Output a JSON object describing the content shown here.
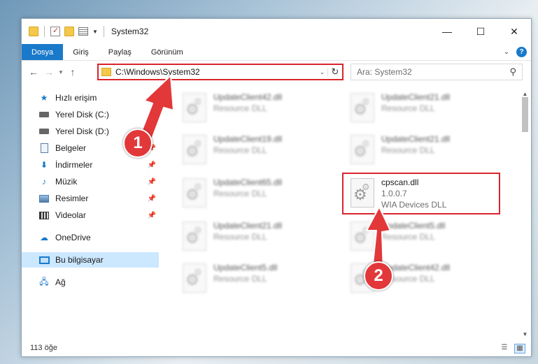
{
  "window": {
    "title": "System32",
    "controls": {
      "minimize": "—",
      "maximize": "☐",
      "close": "✕"
    }
  },
  "ribbon": {
    "tabs": [
      "Dosya",
      "Giriş",
      "Paylaş",
      "Görünüm"
    ],
    "help": "?"
  },
  "navbar": {
    "address": "C:\\Windows\\System32",
    "search_placeholder": "Ara: System32"
  },
  "sidebar": {
    "items": [
      {
        "label": "Hızlı erişim",
        "icon": "star-icon",
        "pinned": false
      },
      {
        "label": "Yerel Disk (C:)",
        "icon": "drive-icon",
        "pinned": true
      },
      {
        "label": "Yerel Disk (D:)",
        "icon": "drive-icon",
        "pinned": true
      },
      {
        "label": "Belgeler",
        "icon": "documents-icon",
        "pinned": true
      },
      {
        "label": "İndirmeler",
        "icon": "downloads-icon",
        "pinned": true
      },
      {
        "label": "Müzik",
        "icon": "music-icon",
        "pinned": true
      },
      {
        "label": "Resimler",
        "icon": "pictures-icon",
        "pinned": true
      },
      {
        "label": "Videolar",
        "icon": "videos-icon",
        "pinned": true
      },
      {
        "label": "OneDrive",
        "icon": "cloud-icon",
        "pinned": false
      },
      {
        "label": "Bu bilgisayar",
        "icon": "computer-icon",
        "pinned": false,
        "selected": true
      },
      {
        "label": "Ağ",
        "icon": "network-icon",
        "pinned": false
      }
    ]
  },
  "files": [
    {
      "name": "UpdateClient42.dll",
      "type": "Resource DLL"
    },
    {
      "name": "UpdateClient21.dll",
      "type": "Resource DLL"
    },
    {
      "name": "UpdateClient19.dll",
      "type": "Resource DLL"
    },
    {
      "name": "UpdateClient21.dll",
      "type": "Resource DLL"
    },
    {
      "name": "UpdateClient65.dll",
      "type": "Resource DLL"
    },
    {
      "name": "cpscan.dll",
      "version": "1.0.0.7",
      "type": "WIA Devices DLL",
      "highlighted": true
    },
    {
      "name": "UpdateClient21.dll",
      "type": "Resource DLL"
    },
    {
      "name": "UpdateClient5.dll",
      "type": "Resource DLL"
    },
    {
      "name": "UpdateClient5.dll",
      "type": "Resource DLL"
    },
    {
      "name": "UpdateClient42.dll",
      "type": "Resource DLL"
    }
  ],
  "status": {
    "count": "113 öğe"
  },
  "annotations": {
    "step1": "1",
    "step2": "2",
    "color": "#e2383a"
  }
}
